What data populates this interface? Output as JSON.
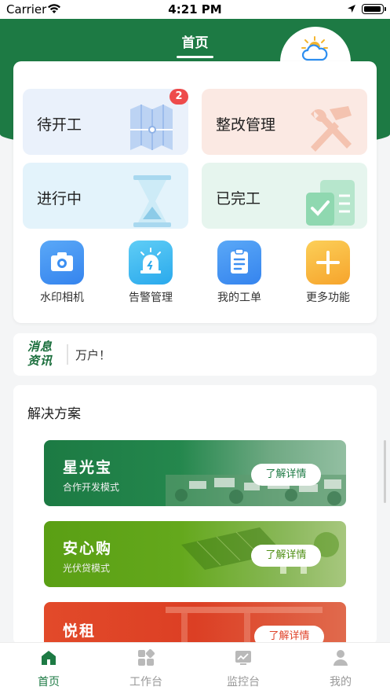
{
  "status_bar": {
    "carrier": "Carrier",
    "time": "4:21 PM"
  },
  "header": {
    "title": "首页"
  },
  "weather": {
    "condition": "阴",
    "icon": "cloud-sun-icon"
  },
  "tiles": [
    {
      "label": "待开工",
      "badge": "2",
      "color": "#eaf1fb",
      "icon": "blueprint-icon"
    },
    {
      "label": "整改管理",
      "color": "#fbe9e3",
      "icon": "wrench-hammer-icon"
    },
    {
      "label": "进行中",
      "color": "#e3f3fb",
      "icon": "hourglass-icon"
    },
    {
      "label": "已完工",
      "color": "#e6f5ee",
      "icon": "checklist-icon"
    }
  ],
  "quick_actions": [
    {
      "label": "水印相机",
      "icon": "camera-icon",
      "color": "#3b8ff2"
    },
    {
      "label": "告警管理",
      "icon": "alarm-icon",
      "color": "#35b7f0"
    },
    {
      "label": "我的工单",
      "icon": "clipboard-icon",
      "color": "#3b8ff2"
    },
    {
      "label": "更多功能",
      "icon": "plus-icon",
      "color": "#f7b23b"
    }
  ],
  "news": {
    "logo_line1": "消息",
    "logo_line2": "资讯",
    "text": "万户！"
  },
  "solutions": {
    "title": "解决方案",
    "items": [
      {
        "title": "星光宝",
        "subtitle": "合作开发模式",
        "button": "了解详情",
        "color": "#1e7f46"
      },
      {
        "title": "安心购",
        "subtitle": "光伏贷模式",
        "button": "了解详情",
        "color": "#5aa016"
      },
      {
        "title": "悦租",
        "subtitle": "",
        "button": "了解详情",
        "color": "#e0432a"
      }
    ]
  },
  "tabbar": [
    {
      "label": "首页",
      "icon": "home-icon",
      "active": true
    },
    {
      "label": "工作台",
      "icon": "apps-icon",
      "active": false
    },
    {
      "label": "监控台",
      "icon": "monitor-chart-icon",
      "active": false
    },
    {
      "label": "我的",
      "icon": "user-icon",
      "active": false
    }
  ]
}
